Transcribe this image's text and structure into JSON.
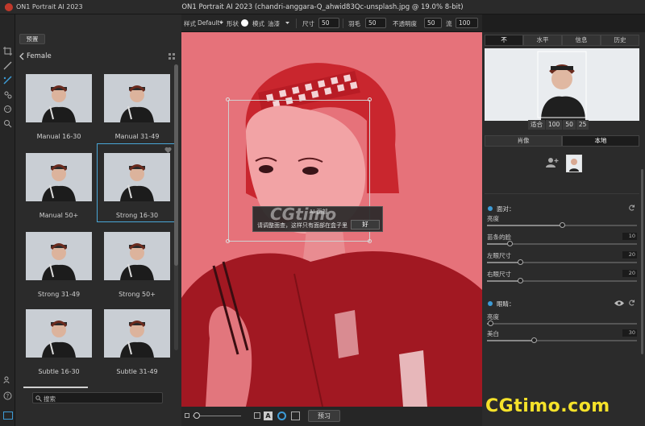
{
  "titlebar": {
    "app_name": "ON1 Portrait AI 2023",
    "window_title": "ON1 Portrait AI 2023 (chandri-anggara-Q_ahwid83Qc-unsplash.jpg @ 19.0% 8-bit)"
  },
  "left_panel": {
    "preset_button": "预置",
    "category": "Female",
    "presets": [
      {
        "label": "Manual 16-30",
        "selected": false
      },
      {
        "label": "Manual 31-49",
        "selected": false
      },
      {
        "label": "Manual 50+",
        "selected": false
      },
      {
        "label": "Strong 16-30",
        "selected": true
      },
      {
        "label": "Strong 31-49",
        "selected": false
      },
      {
        "label": "Strong 50+",
        "selected": false
      },
      {
        "label": "Subtle 16-30",
        "selected": false
      },
      {
        "label": "Subtle 31-49",
        "selected": false
      }
    ],
    "search_placeholder": "搜索"
  },
  "toolbar": {
    "style_label": "样式",
    "style_value": "Default*",
    "shape_label": "形状",
    "mode_label": "模式",
    "mode_value": "油漆",
    "size_label": "尺寸",
    "size_value": "50",
    "feather_label": "羽毛",
    "feather_value": "50",
    "opacity_label": "不透明度",
    "opacity_value": "50",
    "flow_label": "流",
    "flow_value": "100"
  },
  "canvas": {
    "dialog_title": "AI 面部",
    "dialog_message": "请调整面查，这样只有面部在盒子里",
    "dialog_ok": "好",
    "watermark": "CGtimo"
  },
  "bottom_bar": {
    "preview_label": "预习"
  },
  "right_panel": {
    "tabs": [
      "不",
      "水平",
      "信息",
      "历史"
    ],
    "zoom_options": [
      "适合",
      "100",
      "50",
      "25"
    ],
    "mode_tabs": [
      "肖像",
      "本地"
    ],
    "face_section": {
      "title": "面对：",
      "sliders": [
        {
          "label": "亮度",
          "value": "",
          "level": 0.5
        },
        {
          "label": "苗条的脸",
          "value": "10",
          "level": 0.15
        },
        {
          "label": "左眼尺寸",
          "value": "20",
          "level": 0.22
        },
        {
          "label": "右眼尺寸",
          "value": "20",
          "level": 0.22
        }
      ]
    },
    "eyes_section": {
      "title": "眼睛：",
      "sliders": [
        {
          "label": "亮度",
          "value": "",
          "level": 0.02
        },
        {
          "label": "美白",
          "value": "30",
          "level": 0.31
        }
      ]
    }
  },
  "watermark": "CGtimo.com",
  "colors": {
    "accent": "#3d9bd6",
    "mask_overlay": "#e6727a",
    "watermark": "#f5e22a"
  }
}
